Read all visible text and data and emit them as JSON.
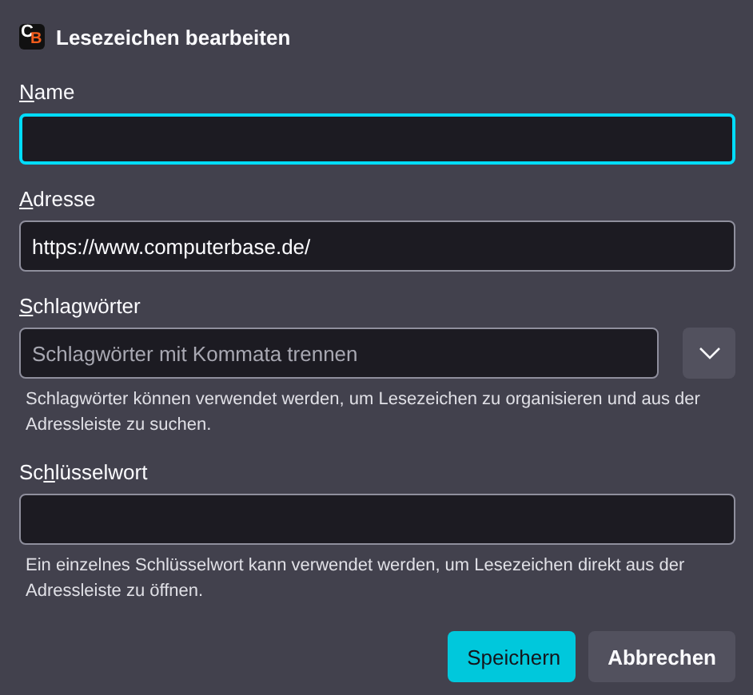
{
  "dialog": {
    "logo": [
      "C",
      "B"
    ],
    "title": "Lesezeichen bearbeiten"
  },
  "fields": [
    {
      "kind": "text",
      "label": {
        "key": "N",
        "rest": "ame"
      },
      "focused": true
    },
    {
      "kind": "text",
      "label": {
        "key": "A",
        "rest": "dresse"
      },
      "value": "https://www.computerbase.de/",
      "focused": false
    },
    {
      "kind": "combo",
      "label": {
        "key": "S",
        "rest": "chlagwörter"
      },
      "placeholder": "Schlagwörter mit Kommata trennen",
      "focused": false,
      "hint": "Schlagwörter können verwendet werden, um Lesezeichen zu organisieren und aus der Adressleiste zu suchen."
    },
    {
      "kind": "text",
      "label": {
        "lead": "Sc",
        "key": "h",
        "rest": "lüsselwort"
      },
      "focused": false,
      "hint": "Ein einzelnes Schlüsselwort kann verwendet werden, um Lesezeichen direkt aus der Adressleiste zu öffnen."
    }
  ],
  "buttons": [
    {
      "label": "Speichern",
      "primary": true
    },
    {
      "label": "Abbrechen",
      "primary": false
    }
  ]
}
